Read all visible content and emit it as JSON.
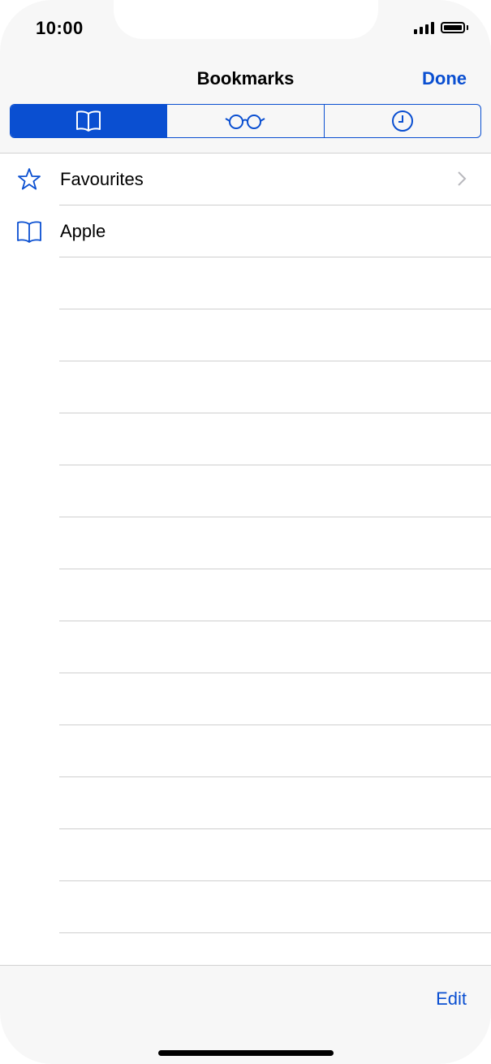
{
  "status_bar": {
    "time": "10:00"
  },
  "nav": {
    "title": "Bookmarks",
    "done_label": "Done"
  },
  "tabs": [
    {
      "name": "bookmarks",
      "icon": "book-icon",
      "selected": true
    },
    {
      "name": "reading-list",
      "icon": "glasses-icon",
      "selected": false
    },
    {
      "name": "history",
      "icon": "clock-icon",
      "selected": false
    }
  ],
  "list": {
    "items": [
      {
        "label": "Favourites",
        "icon": "star-icon",
        "has_chevron": true
      },
      {
        "label": "Apple",
        "icon": "book-icon",
        "has_chevron": false
      }
    ]
  },
  "toolbar": {
    "edit_label": "Edit"
  },
  "colors": {
    "accent": "#0a4fd1",
    "bar_bg": "#f7f7f7",
    "separator": "#cfcfcf"
  }
}
